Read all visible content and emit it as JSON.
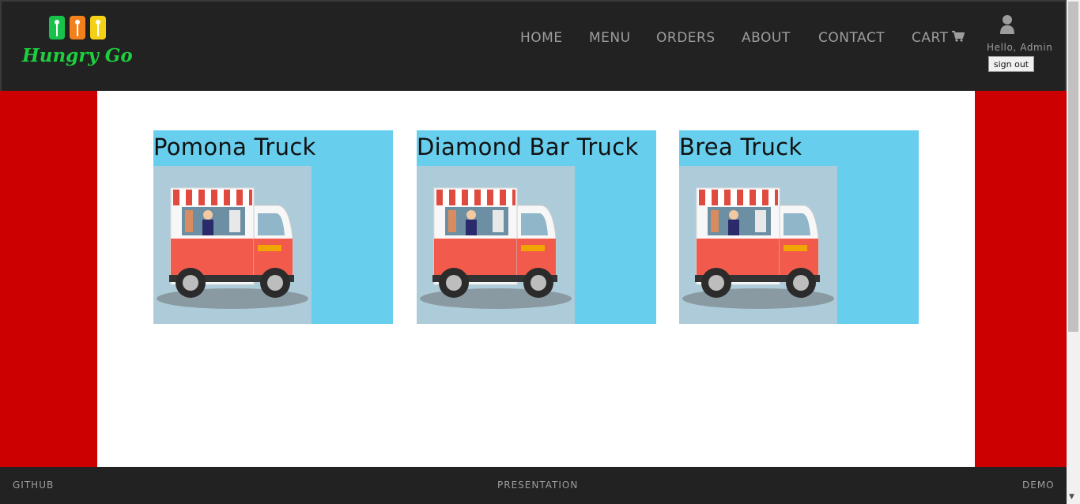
{
  "brand": {
    "logo_text": "Hungry Go",
    "primary_color": "#00c853"
  },
  "nav": {
    "items": [
      {
        "label": "HOME"
      },
      {
        "label": "MENU"
      },
      {
        "label": "ORDERS"
      },
      {
        "label": "ABOUT"
      },
      {
        "label": "CONTACT"
      },
      {
        "label": "CART",
        "icon": "cart-icon"
      }
    ]
  },
  "user": {
    "greeting": "Hello, Admin",
    "signout_label": "sign out",
    "icon": "user-icon"
  },
  "trucks": [
    {
      "name": "Pomona Truck",
      "image": "food-truck-image"
    },
    {
      "name": "Diamond Bar Truck",
      "image": "food-truck-image"
    },
    {
      "name": "Brea Truck",
      "image": "food-truck-image"
    }
  ],
  "footer": {
    "links": [
      {
        "label": "GITHUB"
      },
      {
        "label": "PRESENTATION"
      },
      {
        "label": "DEMO"
      }
    ]
  },
  "colors": {
    "navbar": "#222222",
    "page_background": "#cc0000",
    "card_background": "#67ceed",
    "content": "#ffffff"
  }
}
